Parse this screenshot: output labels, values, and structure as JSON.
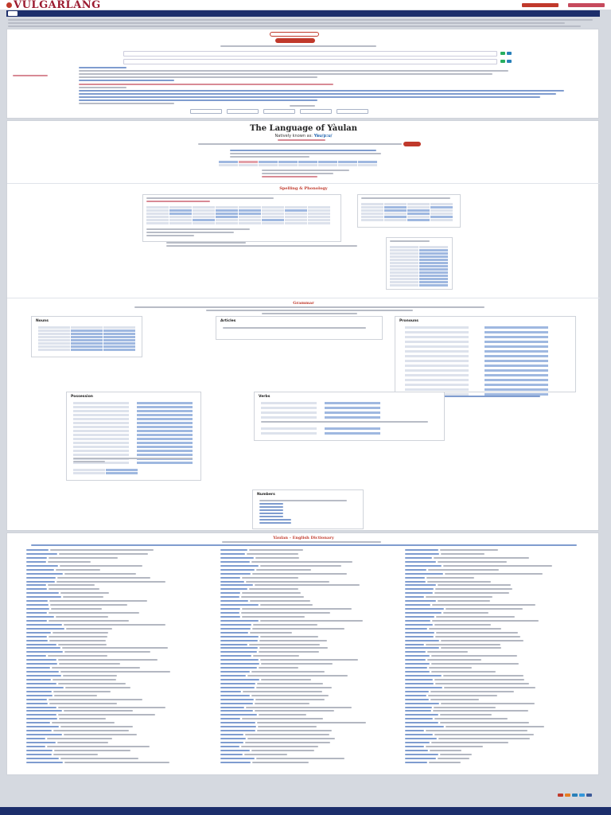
{
  "header": {
    "logo": "VULGARLANG",
    "tagline_lines": [
      "",
      ""
    ]
  },
  "nav": {
    "items": [
      {
        "label": ""
      },
      {
        "label": ""
      },
      {
        "label": ""
      },
      {
        "label": ""
      },
      {
        "label": ""
      },
      {
        "label": ""
      },
      {
        "label": ""
      },
      {
        "label": ""
      }
    ]
  },
  "language": {
    "title": "The Language of Yàulan",
    "native_prefix": "Natively known as:",
    "native_name": "Yàu/p:u/"
  },
  "sections": {
    "spelling_phonology": "Spelling & Phonology",
    "grammar": "Grammar",
    "dictionary": "Yàulan - English Dictionary"
  },
  "grammar_boxes": {
    "nouns": "Nouns",
    "articles": "Articles",
    "pronouns": "Pronouns",
    "possession": "Possession",
    "verbs": "Verbs",
    "numbers": "Numbers"
  },
  "colors": {
    "brand": "#9b1b30",
    "accent": "#c0392b",
    "nav": "#1c2e6b",
    "link": "#2e6db4"
  },
  "footer": {
    "version": ""
  }
}
